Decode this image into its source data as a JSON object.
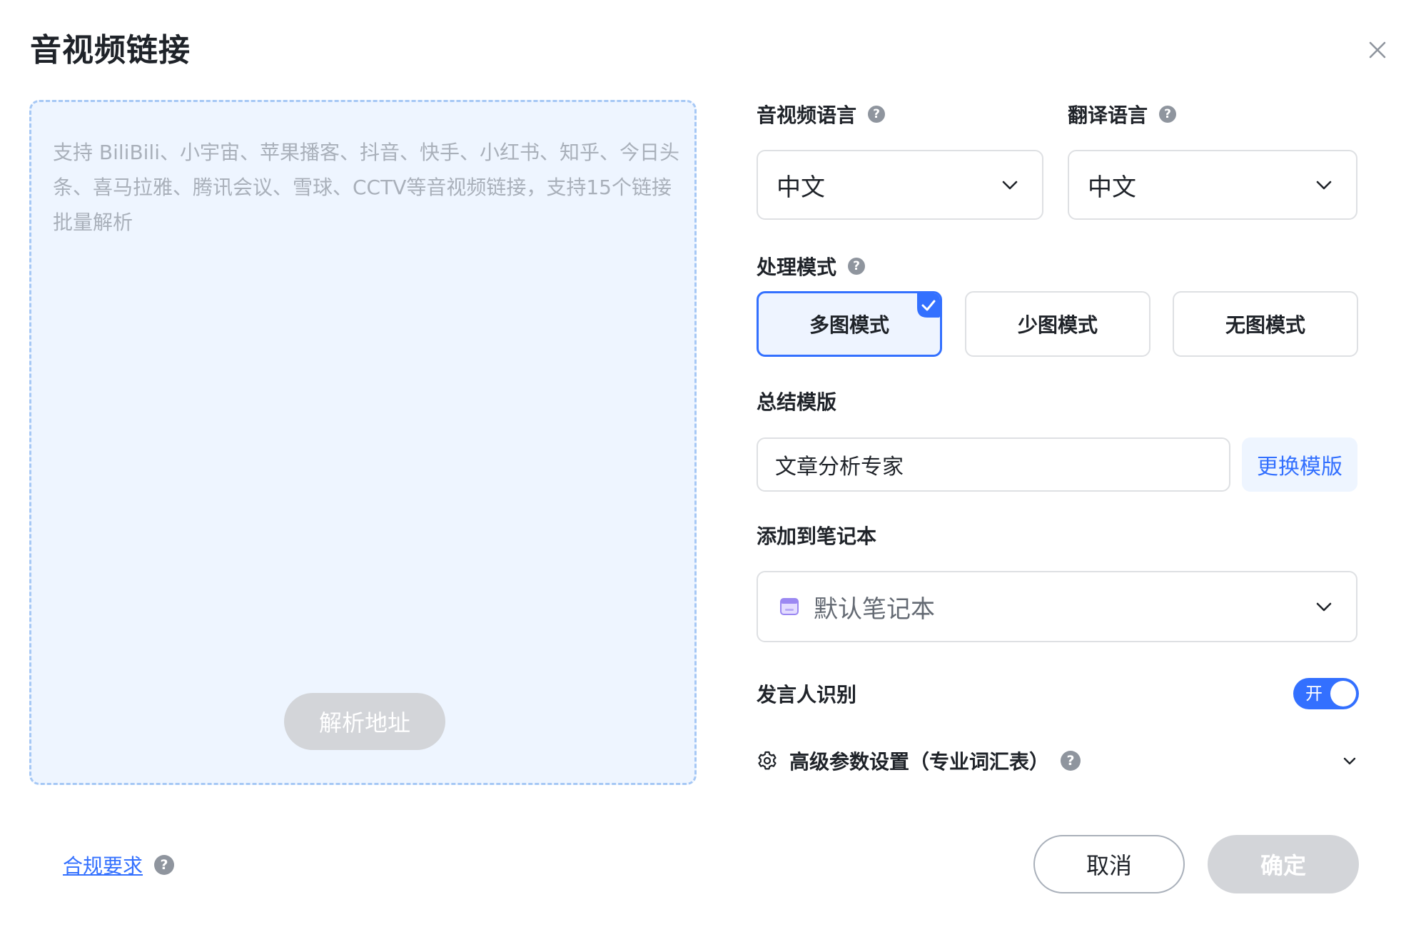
{
  "dialog": {
    "title": "音视频链接"
  },
  "link_input": {
    "value": "",
    "placeholder": "支持 BiliBili、小宇宙、苹果播客、抖音、快手、小红书、知乎、今日头条、喜马拉雅、腾讯会议、雪球、CCTV等音视频链接，支持15个链接批量解析",
    "parse_label": "解析地址"
  },
  "audio_language": {
    "label": "音视频语言",
    "value": "中文"
  },
  "translate_language": {
    "label": "翻译语言",
    "value": "中文"
  },
  "processing_mode": {
    "label": "处理模式",
    "options": [
      {
        "label": "多图模式",
        "selected": true
      },
      {
        "label": "少图模式",
        "selected": false
      },
      {
        "label": "无图模式",
        "selected": false
      }
    ]
  },
  "summary_template": {
    "label": "总结模版",
    "value": "文章分析专家",
    "change_label": "更换模版"
  },
  "notebook": {
    "label": "添加到笔记本",
    "value": "默认笔记本"
  },
  "speaker_recognition": {
    "label": "发言人识别",
    "toggle_text": "开",
    "enabled": true
  },
  "advanced": {
    "label": "高级参数设置（专业词汇表）"
  },
  "footer": {
    "compliance_label": "合规要求",
    "cancel_label": "取消",
    "confirm_label": "确定"
  },
  "icons": {
    "close": "close-icon",
    "help": "question-circle-icon",
    "chevron": "chevron-down-icon",
    "check": "check-icon",
    "notebook": "notebook-icon",
    "gear": "gear-icon"
  },
  "colors": {
    "accent": "#3370ff",
    "disabled": "#d3d5d9",
    "dropzone_bg": "#eef5ff",
    "dropzone_border": "#a6c8f5"
  }
}
